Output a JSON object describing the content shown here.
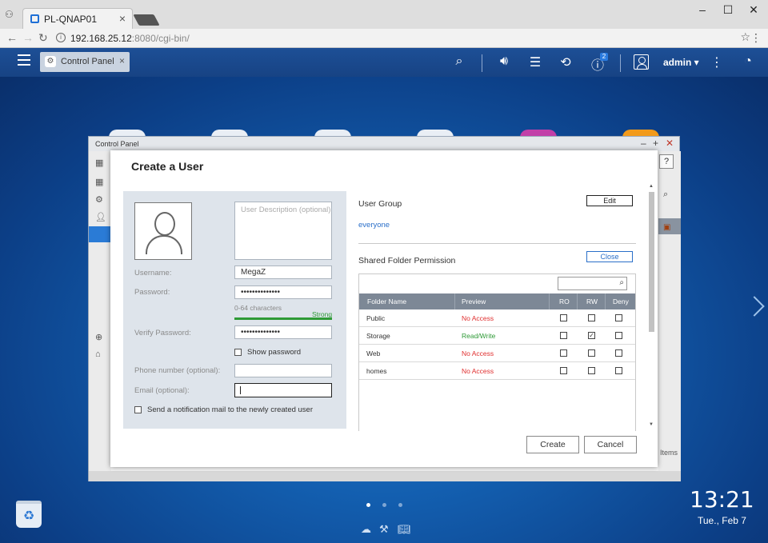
{
  "browser": {
    "tab_title": "PL-QNAP01",
    "tab_close": "×",
    "url_host": "192.168.25.12",
    "url_rest": ":8080/cgi-bin/"
  },
  "qts": {
    "app_tab": "Control Panel",
    "app_tab_close": "×",
    "notification_count": "2",
    "user": "admin ▾"
  },
  "control_panel": {
    "window_title": "Control Panel",
    "help": "?",
    "items_label": "Items"
  },
  "dialog": {
    "title": "Create a User",
    "description_placeholder": "User Description (optional)",
    "username_label": "Username:",
    "username_value": "MegaZ",
    "password_label": "Password:",
    "password_value": "••••••••••••••",
    "password_hint": "0-64 characters",
    "strength_label": "Strong",
    "verify_label": "Verify Password:",
    "verify_value": "••••••••••••••",
    "show_password": "Show password",
    "phone_label": "Phone number (optional):",
    "email_label": "Email (optional):",
    "notify_label": "Send a notification mail to the newly created user",
    "user_group_label": "User Group",
    "edit_button": "Edit",
    "group_value": "everyone",
    "shared_folder_label": "Shared Folder Permission",
    "close_button": "Close",
    "columns": [
      "Folder Name",
      "Preview",
      "RO",
      "RW",
      "Deny"
    ],
    "rows": [
      {
        "name": "Public",
        "preview": "No Access",
        "preview_color": "#e03030",
        "ro": false,
        "rw": false,
        "deny": false
      },
      {
        "name": "Storage",
        "preview": "Read/Write",
        "preview_color": "#2e9a36",
        "ro": false,
        "rw": true,
        "deny": false
      },
      {
        "name": "Web",
        "preview": "No Access",
        "preview_color": "#e03030",
        "ro": false,
        "rw": false,
        "deny": false
      },
      {
        "name": "homes",
        "preview": "No Access",
        "preview_color": "#e03030",
        "ro": false,
        "rw": false,
        "deny": false
      }
    ],
    "create_button": "Create",
    "cancel_button": "Cancel"
  },
  "desktop": {
    "time": "13:21",
    "date": "Tue., Feb 7",
    "page_dots": 3,
    "active_dot": 0
  },
  "colors": {
    "accent": "#2a6fc9",
    "no_access": "#e03030",
    "read_write": "#2e9a36",
    "qts_bar": "#1d4f96"
  }
}
